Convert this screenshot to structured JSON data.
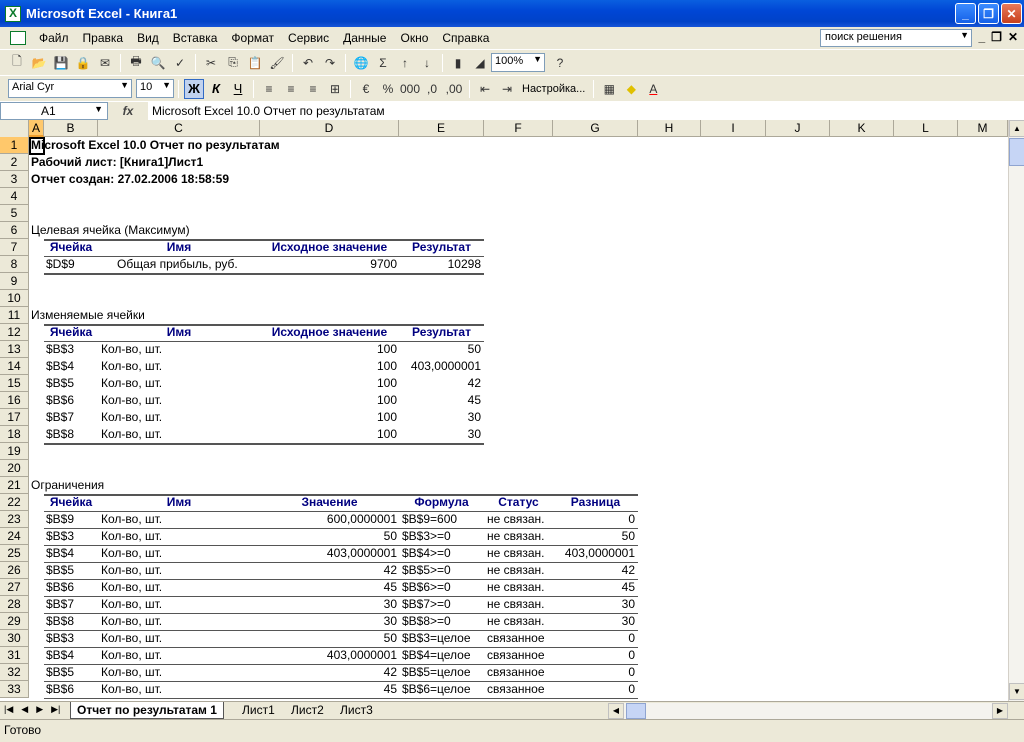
{
  "window": {
    "title": "Microsoft Excel - Книга1",
    "min_icon": "minimize-icon",
    "max_icon": "restore-icon",
    "close_icon": "close-icon"
  },
  "menu": {
    "items": [
      "Файл",
      "Правка",
      "Вид",
      "Вставка",
      "Формат",
      "Сервис",
      "Данные",
      "Окно",
      "Справка"
    ],
    "help_search": "поиск решения"
  },
  "toolbar": {
    "zoom": "100%",
    "font_name": "Arial Cyr",
    "font_size": "10",
    "bold_label": "Ж",
    "italic_label": "К",
    "underline_label": "Ч",
    "customize_label": "Настройка..."
  },
  "formula_bar": {
    "name_box": "A1",
    "fx": "fx",
    "value": "Microsoft Excel 10.0 Отчет по результатам"
  },
  "columns": [
    "A",
    "B",
    "C",
    "D",
    "E",
    "F",
    "G",
    "H",
    "I",
    "J",
    "K",
    "L",
    "M"
  ],
  "rows": [
    "1",
    "2",
    "3",
    "4",
    "5",
    "6",
    "7",
    "8",
    "9",
    "10",
    "11",
    "12",
    "13",
    "14",
    "15",
    "16",
    "17",
    "18",
    "19",
    "20",
    "21",
    "22",
    "23",
    "24",
    "25",
    "26",
    "27",
    "28",
    "29",
    "30",
    "31",
    "32",
    "33"
  ],
  "report": {
    "title": "Microsoft Excel 10.0 Отчет по результатам",
    "worksheet": "Рабочий лист: [Книга1]Лист1",
    "created": "Отчет создан: 27.02.2006 18:58:59",
    "target_section": "Целевая ячейка (Максимум)",
    "target_headers": [
      "Ячейка",
      "Имя",
      "Исходное значение",
      "Результат"
    ],
    "target_rows": [
      [
        "$D$9",
        "Общая прибыль,  руб.",
        "9700",
        "10298"
      ]
    ],
    "changing_section": "Изменяемые ячейки",
    "changing_headers": [
      "Ячейка",
      "Имя",
      "Исходное значение",
      "Результат"
    ],
    "changing_rows": [
      [
        "$B$3",
        "Кол-во, шт.",
        "100",
        "50"
      ],
      [
        "$B$4",
        "Кол-во, шт.",
        "100",
        "403,0000001"
      ],
      [
        "$B$5",
        "Кол-во, шт.",
        "100",
        "42"
      ],
      [
        "$B$6",
        "Кол-во, шт.",
        "100",
        "45"
      ],
      [
        "$B$7",
        "Кол-во, шт.",
        "100",
        "30"
      ],
      [
        "$B$8",
        "Кол-во, шт.",
        "100",
        "30"
      ]
    ],
    "constraints_section": "Ограничения",
    "constraints_headers": [
      "Ячейка",
      "Имя",
      "Значение",
      "Формула",
      "Статус",
      "Разница"
    ],
    "constraints_rows": [
      [
        "$B$9",
        "Кол-во, шт.",
        "600,0000001",
        "$B$9=600",
        "не связан.",
        "0"
      ],
      [
        "$B$3",
        "Кол-во, шт.",
        "50",
        "$B$3>=0",
        "не связан.",
        "50"
      ],
      [
        "$B$4",
        "Кол-во, шт.",
        "403,0000001",
        "$B$4>=0",
        "не связан.",
        "403,0000001"
      ],
      [
        "$B$5",
        "Кол-во, шт.",
        "42",
        "$B$5>=0",
        "не связан.",
        "42"
      ],
      [
        "$B$6",
        "Кол-во, шт.",
        "45",
        "$B$6>=0",
        "не связан.",
        "45"
      ],
      [
        "$B$7",
        "Кол-во, шт.",
        "30",
        "$B$7>=0",
        "не связан.",
        "30"
      ],
      [
        "$B$8",
        "Кол-во, шт.",
        "30",
        "$B$8>=0",
        "не связан.",
        "30"
      ],
      [
        "$B$3",
        "Кол-во, шт.",
        "50",
        "$B$3=целое",
        "связанное",
        "0"
      ],
      [
        "$B$4",
        "Кол-во, шт.",
        "403,0000001",
        "$B$4=целое",
        "связанное",
        "0"
      ],
      [
        "$B$5",
        "Кол-во, шт.",
        "42",
        "$B$5=целое",
        "связанное",
        "0"
      ],
      [
        "$B$6",
        "Кол-во, шт.",
        "45",
        "$B$6=целое",
        "связанное",
        "0"
      ]
    ]
  },
  "sheets": {
    "tabs": [
      "Отчет по результатам 1",
      "Лист1",
      "Лист2",
      "Лист3"
    ],
    "active": "Отчет по результатам 1"
  },
  "status": {
    "text": "Готово"
  }
}
